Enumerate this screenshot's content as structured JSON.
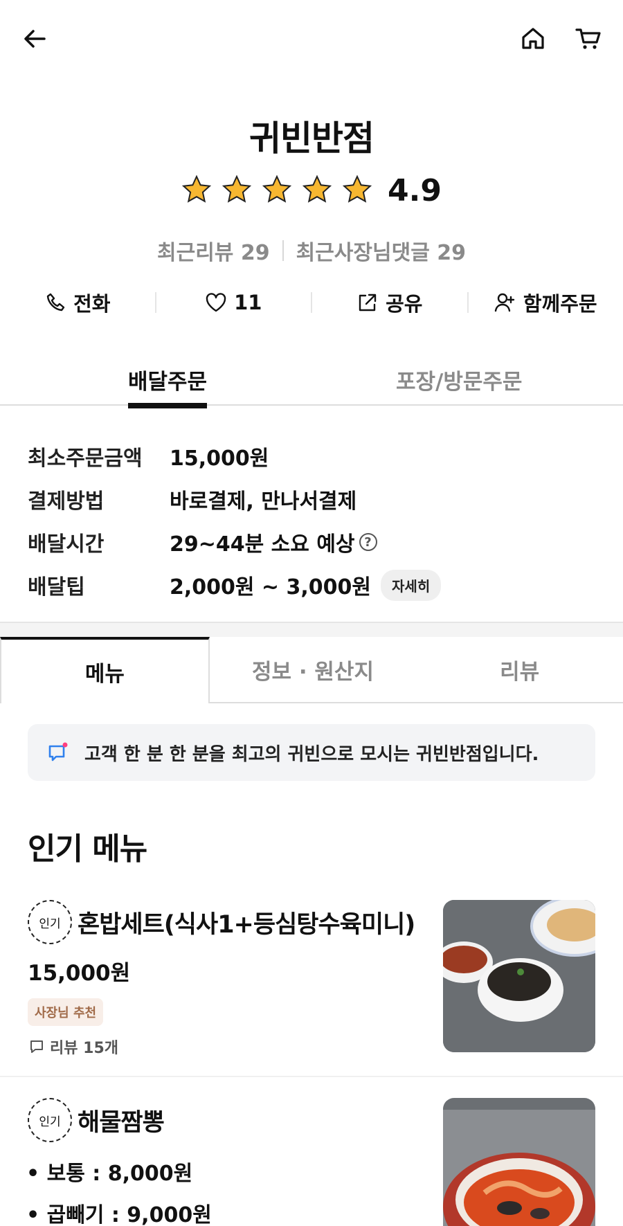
{
  "store": {
    "name": "귀빈반점",
    "rating": "4.9",
    "stars": 5,
    "recent_reviews": "최근리뷰 29",
    "recent_owner_replies": "최근사장님댓글 29"
  },
  "actions": {
    "call": "전화",
    "like_count": "11",
    "share": "공유",
    "group_order": "함께주문"
  },
  "order_tabs": {
    "delivery": "배달주문",
    "pickup": "포장/방문주문"
  },
  "info": [
    {
      "label": "최소주문금액",
      "value": "15,000원"
    },
    {
      "label": "결제방법",
      "value": "바로결제, 만나서결제"
    },
    {
      "label": "배달시간",
      "value": "29~44분 소요 예상"
    },
    {
      "label": "배달팁",
      "value": "2,000원 ~ 3,000원"
    }
  ],
  "detail_chip": "자세히",
  "help_icon": "?",
  "menu_tabs": [
    "메뉴",
    "정보 · 원산지",
    "리뷰"
  ],
  "notice": "고객 한 분 한 분을 최고의 귀빈으로 모시는 귀빈반점입니다.",
  "section_title": "인기 메뉴",
  "menu_items": [
    {
      "badge": "인기",
      "name": "혼밥세트(식사1+등심탕수육미니)",
      "price": "15,000원",
      "tag": "사장님 추천",
      "reviews": "리뷰 15개"
    },
    {
      "badge": "인기",
      "name": "해물짬뽕",
      "options": [
        "• 보통 : 8,000원",
        "• 곱빼기 : 9,000원"
      ]
    }
  ],
  "icons": {
    "back": "arrow-left-icon",
    "home": "home-icon",
    "cart": "cart-icon",
    "phone": "phone-icon",
    "heart": "heart-icon",
    "share": "share-icon",
    "group": "add-user-icon",
    "notice": "chat-notice-icon",
    "review": "comment-icon"
  },
  "colors": {
    "star": "#F7B731",
    "owner_chip_bg": "#F8EEE8",
    "owner_chip_text": "#A06A48",
    "notice_dot": "#FF3F7F",
    "notice_icon": "#2F80ED"
  }
}
